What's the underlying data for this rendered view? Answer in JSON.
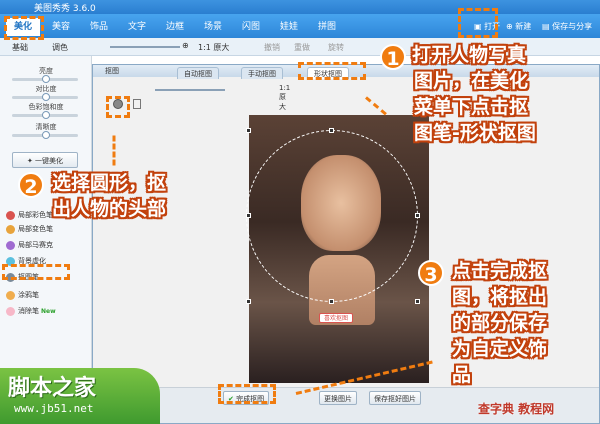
{
  "app": {
    "title": "美图秀秀 3.6.0"
  },
  "menu": {
    "items": [
      {
        "label": "美化",
        "active": true
      },
      {
        "label": "美容"
      },
      {
        "label": "饰品"
      },
      {
        "label": "文字"
      },
      {
        "label": "边框"
      },
      {
        "label": "场景"
      },
      {
        "label": "闪图"
      },
      {
        "label": "娃娃"
      },
      {
        "label": "拼图"
      }
    ],
    "open_label": "打开",
    "new_label": "新建",
    "save_label": "保存与分享"
  },
  "subtoolbar": {
    "tab1": "基础",
    "tab2": "调色",
    "zoom": "1:1 原大",
    "rotate": "旋转",
    "undo": "撤销",
    "redo": "重做"
  },
  "left_panel": {
    "sliders": [
      "亮度",
      "对比度",
      "色彩饱和度",
      "清晰度"
    ],
    "one_click": "一键美化",
    "tools": [
      "局部彩色笔",
      "局部变色笔",
      "局部马赛克",
      "背景虚化",
      "抠图笔",
      "涂鸦笔",
      "消除笔"
    ],
    "new_badge": "New"
  },
  "dialog": {
    "title": "抠图",
    "tabs": [
      "自动抠图",
      "手动抠图",
      "形状抠图"
    ],
    "zoom": "1:1 原大",
    "fav_button": "喜欢抠图",
    "buttons": {
      "done": "完成抠图",
      "change": "更换图片",
      "save": "保存抠好图片"
    }
  },
  "annotations": {
    "step1_num": "1",
    "step1": [
      "打开人物写真",
      "图片，在美化",
      "菜单下点击抠",
      "图笔-形状抠图"
    ],
    "step2_num": "2",
    "step2": [
      "选择圆形，抠",
      "出人物的头部"
    ],
    "step3_num": "3",
    "step3": [
      "点击完成抠",
      "图，将抠出",
      "的部分保存",
      "为自定义饰",
      "品"
    ]
  },
  "watermarks": {
    "left_big": "脚本之家",
    "left_small": "www.jb51.net",
    "right": "查字典 教程网"
  },
  "colors": {
    "accent": "#f07c10",
    "menu_blue": "#2d86d8",
    "watermark_green": "#4fa834"
  }
}
